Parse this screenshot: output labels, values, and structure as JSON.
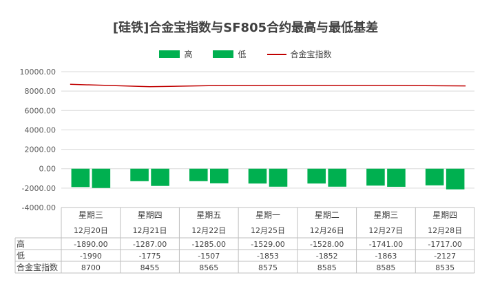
{
  "colors": {
    "bar_high": "#00b050",
    "bar_low": "#00b050",
    "line": "#c00000",
    "grid": "#d9d9d9",
    "table_border": "#bfbfbf"
  },
  "chart_data": {
    "type": "bar",
    "title": "[硅铁]合金宝指数与SF805合约最高与最低基差",
    "categories": [
      "星期三",
      "星期四",
      "星期五",
      "星期一",
      "星期二",
      "星期三",
      "星期四"
    ],
    "dates": [
      "12月20日",
      "12月21日",
      "12月22日",
      "12月25日",
      "12月26日",
      "12月27日",
      "12月28日"
    ],
    "series": [
      {
        "name": "高",
        "type": "bar",
        "values": [
          -1890,
          -1287,
          -1285,
          -1529,
          -1528,
          -1741,
          -1717
        ],
        "labels": [
          "-1890.00",
          "-1287.00",
          "-1285.00",
          "-1529.00",
          "-1528.00",
          "-1741.00",
          "-1717.00"
        ]
      },
      {
        "name": "低",
        "type": "bar",
        "values": [
          -1990,
          -1775,
          -1507,
          -1853,
          -1852,
          -1863,
          -2127
        ],
        "labels": [
          "-1990",
          "-1775",
          "-1507",
          "-1853",
          "-1852",
          "-1863",
          "-2127"
        ]
      },
      {
        "name": "合金宝指数",
        "type": "line",
        "values": [
          8700,
          8455,
          8565,
          8575,
          8585,
          8585,
          8535
        ],
        "labels": [
          "8700",
          "8455",
          "8565",
          "8575",
          "8585",
          "8585",
          "8535"
        ]
      }
    ],
    "ylim": [
      -4000,
      10000
    ],
    "yticks": [
      "10000.00",
      "8000.00",
      "6000.00",
      "4000.00",
      "2000.00",
      "0.00",
      "-2000.00",
      "-4000.00"
    ],
    "ytick_values": [
      10000,
      8000,
      6000,
      4000,
      2000,
      0,
      -2000,
      -4000
    ],
    "grid": true,
    "legend": "top-center",
    "data_table": true
  }
}
